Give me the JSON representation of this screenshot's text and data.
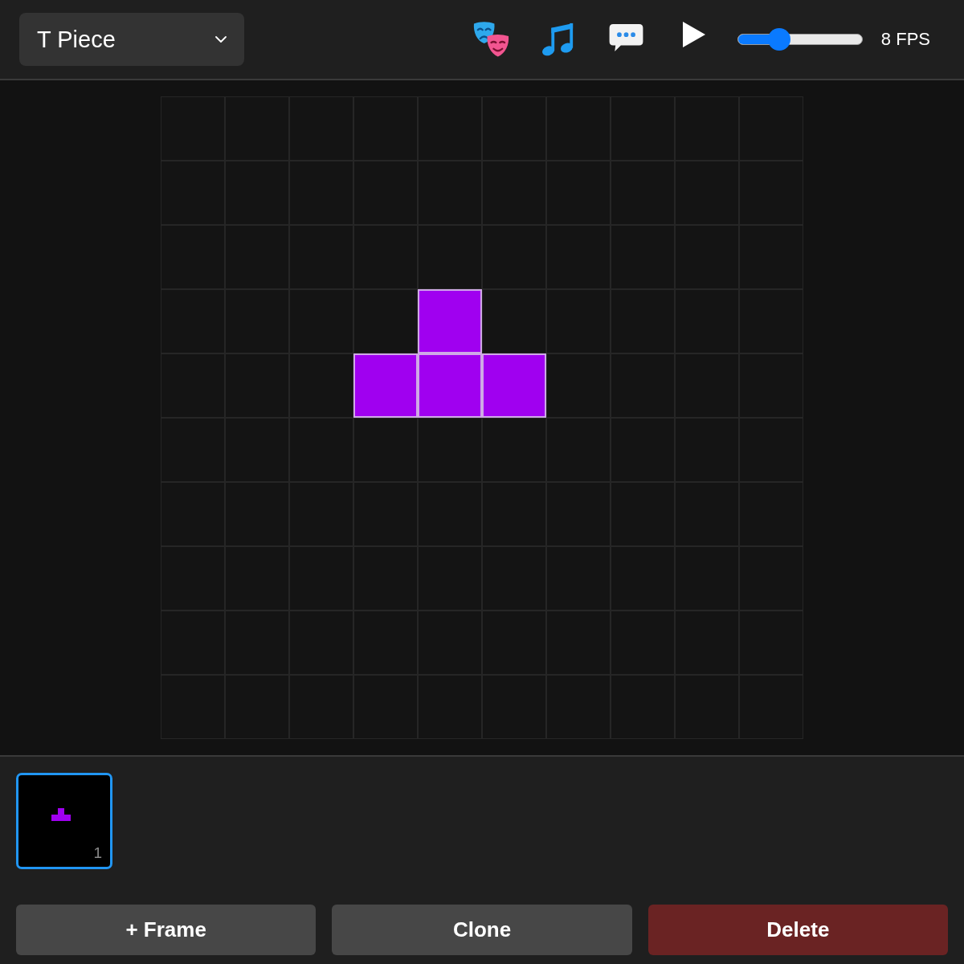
{
  "piece_select": {
    "value": "T Piece"
  },
  "playback": {
    "playing": false
  },
  "speed_slider": {
    "level": 0.3,
    "reading": "8 FPS"
  },
  "frames": [
    {
      "label": "1",
      "selected": true,
      "cells": [
        [
          false,
          false,
          false,
          false,
          false,
          false,
          false,
          false,
          false,
          false
        ],
        [
          false,
          false,
          false,
          false,
          false,
          false,
          false,
          false,
          false,
          false
        ],
        [
          false,
          false,
          false,
          false,
          false,
          false,
          false,
          false,
          false,
          false
        ],
        [
          false,
          false,
          false,
          false,
          true,
          false,
          false,
          false,
          false,
          false
        ],
        [
          false,
          false,
          false,
          true,
          true,
          true,
          false,
          false,
          false,
          false
        ],
        [
          false,
          false,
          false,
          false,
          false,
          false,
          false,
          false,
          false,
          false
        ],
        [
          false,
          false,
          false,
          false,
          false,
          false,
          false,
          false,
          false,
          false
        ],
        [
          false,
          false,
          false,
          false,
          false,
          false,
          false,
          false,
          false,
          false
        ],
        [
          false,
          false,
          false,
          false,
          false,
          false,
          false,
          false,
          false,
          false
        ],
        [
          false,
          false,
          false,
          false,
          false,
          false,
          false,
          false,
          false,
          false
        ]
      ]
    }
  ],
  "actions": [
    {
      "label": "+ Frame",
      "kind": "neutral"
    },
    {
      "label": "Clone",
      "kind": "neutral"
    },
    {
      "label": "Delete",
      "kind": "danger"
    }
  ]
}
